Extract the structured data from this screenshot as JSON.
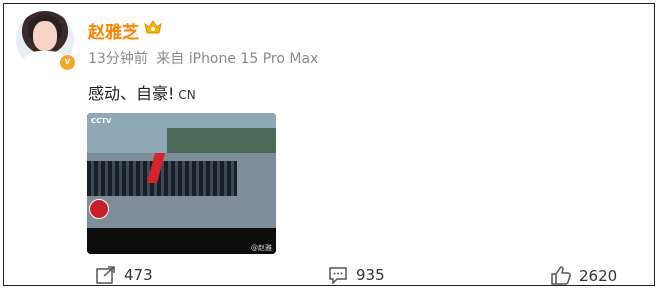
{
  "post": {
    "username": "赵雅芝",
    "meta_time": "13分钟前",
    "meta_source": "来自 iPhone 15 Pro Max",
    "content": "感动、自豪!",
    "content_tag": "CN"
  },
  "photo": {
    "tv_logo": "CCTV",
    "watermark": "@赵雅"
  },
  "actions": {
    "share_count": "473",
    "comment_count": "935",
    "like_count": "2620"
  },
  "icons": [
    "share-icon",
    "comment-icon",
    "like-icon",
    "verified-icon",
    "vip-icon"
  ],
  "colors": {
    "username": "#ff8200",
    "meta": "#8a8a8a",
    "verified": "#f6a623"
  }
}
